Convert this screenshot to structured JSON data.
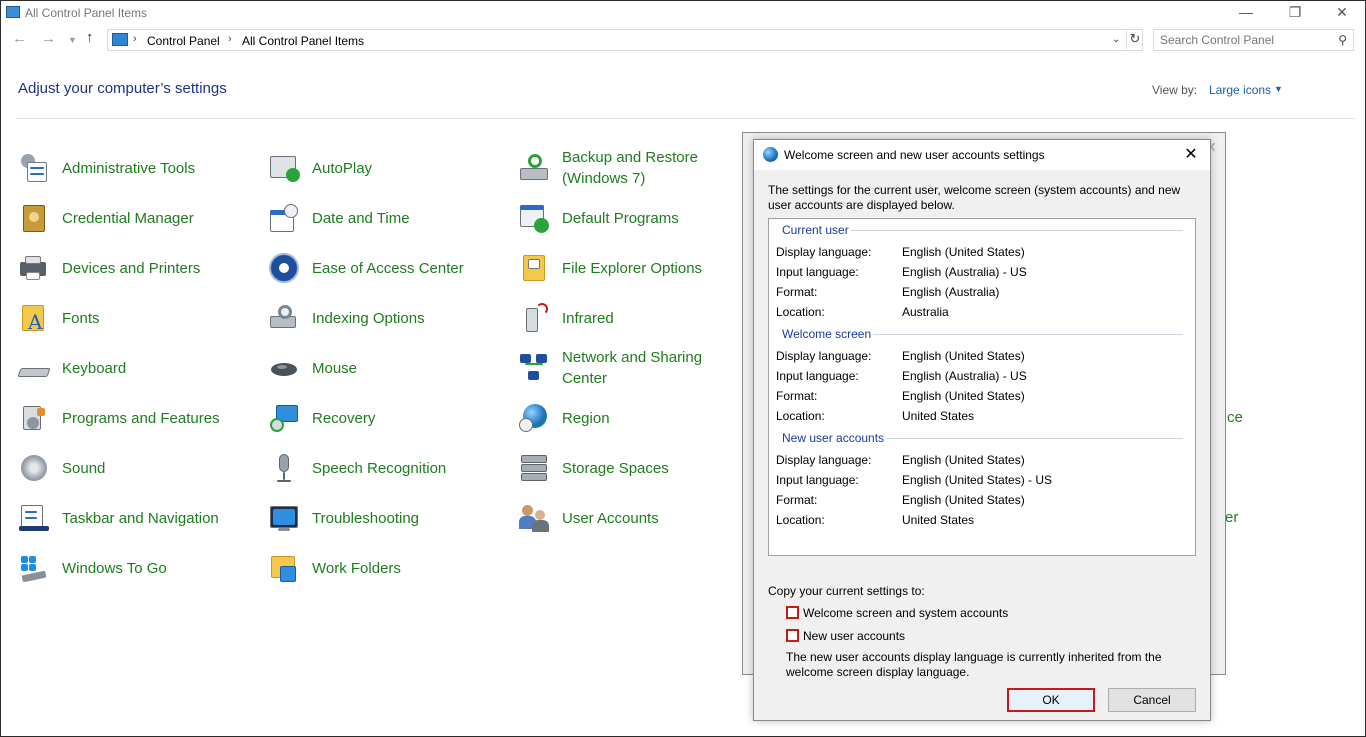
{
  "window": {
    "title": "All Control Panel Items"
  },
  "nav": {
    "breadcrumb": [
      "Control Panel",
      "All Control Panel Items"
    ],
    "search_placeholder": "Search Control Panel"
  },
  "header": {
    "title": "Adjust your computer’s settings",
    "view_by_label": "View by:",
    "view_by_value": "Large icons"
  },
  "items": {
    "col1": [
      "Administrative Tools",
      "Credential Manager",
      "Devices and Printers",
      "Fonts",
      "Keyboard",
      "Programs and Features",
      "Sound",
      "Taskbar and Navigation",
      "Windows To Go"
    ],
    "col2": [
      "AutoPlay",
      "Date and Time",
      "Ease of Access Center",
      "Indexing Options",
      "Mouse",
      "Recovery",
      "Speech Recognition",
      "Troubleshooting",
      "Work Folders"
    ],
    "col3": [
      "Backup and Restore (Windows 7)",
      "Default Programs",
      "File Explorer Options",
      "Infrared",
      "Network and Sharing Center",
      "Region",
      "Storage Spaces",
      "User Accounts"
    ],
    "peek": [
      "ce",
      "er"
    ]
  },
  "dialog": {
    "title": "Welcome screen and new user accounts settings",
    "description": "The settings for the current user, welcome screen (system accounts) and new user accounts are displayed below.",
    "keys": {
      "display_language": "Display language:",
      "input_language": "Input language:",
      "format": "Format:",
      "location": "Location:"
    },
    "current_user": {
      "heading": "Current user",
      "display_language": "English (United States)",
      "input_language": "English (Australia) - US",
      "format": "English (Australia)",
      "location": "Australia"
    },
    "welcome_screen": {
      "heading": "Welcome screen",
      "display_language": "English (United States)",
      "input_language": "English (Australia) - US",
      "format": "English (United States)",
      "location": "United States"
    },
    "new_user_accounts": {
      "heading": "New user accounts",
      "display_language": "English (United States)",
      "input_language": "English (United States) - US",
      "format": "English (United States)",
      "location": "United States"
    },
    "copy_label": "Copy your current settings to:",
    "checkbox_welcome": "Welcome screen and system accounts",
    "checkbox_new_users": "New user accounts",
    "note": "The new user accounts display language is currently inherited from the welcome screen display language.",
    "ok": "OK",
    "cancel": "Cancel"
  },
  "colors": {
    "link_green": "#1e7d1e",
    "title_blue": "#1e3287",
    "highlight_red": "#c41a1a"
  }
}
